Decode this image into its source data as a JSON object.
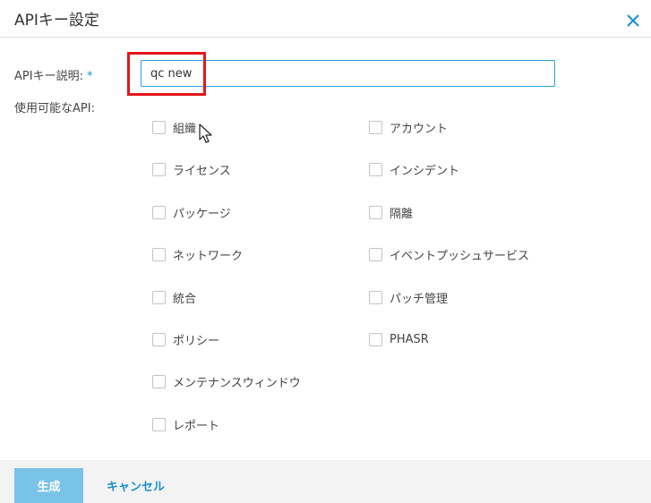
{
  "dialog": {
    "title": "APIキー設定",
    "close_icon": "close-icon"
  },
  "form": {
    "description_label": "APIキー説明:",
    "required_mark": "*",
    "description_value": "qc new",
    "apis_label": "使用可能なAPI:"
  },
  "apis": {
    "left": [
      "組織",
      "ライセンス",
      "パッケージ",
      "ネットワーク",
      "統合",
      "ポリシー",
      "メンテナンスウィンドウ",
      "レポート"
    ],
    "right": [
      "アカウント",
      "インシデント",
      "隔離",
      "イベントプッシュサービス",
      "パッチ管理",
      "PHASR"
    ]
  },
  "footer": {
    "create_label": "生成",
    "cancel_label": "キャンセル"
  },
  "colors": {
    "accent": "#1a8fcf",
    "create_button": "#7ac3e8",
    "highlight": "#e4161b",
    "input_border": "#2aa1d9"
  }
}
